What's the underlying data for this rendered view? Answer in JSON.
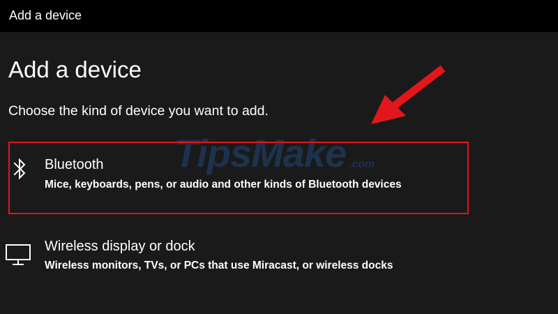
{
  "window": {
    "title": "Add a device"
  },
  "page": {
    "heading": "Add a device",
    "subheading": "Choose the kind of device you want to add."
  },
  "options": [
    {
      "label": "Bluetooth",
      "description": "Mice, keyboards, pens, or audio and other kinds of Bluetooth devices",
      "icon": "bluetooth-icon",
      "highlighted": true
    },
    {
      "label": "Wireless display or dock",
      "description": "Wireless monitors, TVs, or PCs that use Miracast, or wireless docks",
      "icon": "monitor-icon",
      "highlighted": false
    }
  ],
  "annotation": {
    "color": "#e3161b",
    "arrow_icon": "red-arrow-icon"
  },
  "watermark": {
    "main": "TipsMake",
    "domain": ".com"
  },
  "colors": {
    "background": "#1a1a1a",
    "titlebar": "#000000",
    "text": "#ffffff",
    "highlight": "#e3161b"
  }
}
